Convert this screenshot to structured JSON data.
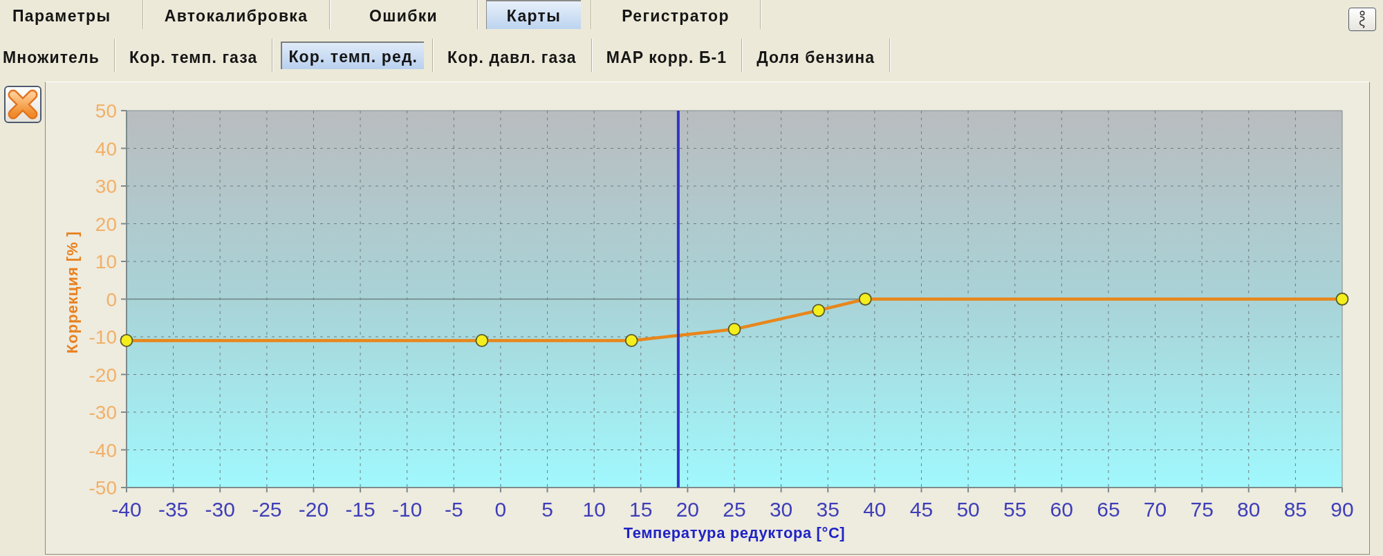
{
  "tabs": [
    {
      "label": "Параметры",
      "selected": false
    },
    {
      "label": "Автокалибровка",
      "selected": false
    },
    {
      "label": "Ошибки",
      "selected": false
    },
    {
      "label": "Карты",
      "selected": true
    },
    {
      "label": "Регистратор",
      "selected": false
    }
  ],
  "subtabs": [
    {
      "label": "Множитель",
      "selected": false
    },
    {
      "label": "Кор. темп. газа",
      "selected": false
    },
    {
      "label": "Кор. темп. ред.",
      "selected": true
    },
    {
      "label": "Кор. давл. газа",
      "selected": false
    },
    {
      "label": "MAP корр. Б-1",
      "selected": false
    },
    {
      "label": "Доля бензина",
      "selected": false
    }
  ],
  "chart": {
    "chart_data": {
      "type": "line",
      "xlabel": "Температура редуктора [°C]",
      "ylabel": "Коррекция [% ]",
      "x": [
        -40,
        -2,
        14,
        25,
        34,
        39,
        90
      ],
      "series": [
        {
          "color": "#e8861a",
          "marker": "circle",
          "values": [
            -11,
            -11,
            -11,
            -8,
            -3,
            0,
            0
          ]
        }
      ],
      "xlim": [
        -40,
        90
      ],
      "ylim": [
        -50,
        50
      ],
      "xticks": [
        -40,
        -35,
        -30,
        -25,
        -20,
        -15,
        -10,
        -5,
        0,
        5,
        10,
        15,
        20,
        25,
        30,
        35,
        40,
        45,
        50,
        55,
        60,
        65,
        70,
        75,
        80,
        85,
        90
      ],
      "yticks": [
        -50,
        -40,
        -30,
        -20,
        -10,
        0,
        10,
        20,
        30,
        40,
        50
      ],
      "grid": true,
      "ref_lines": [
        {
          "axis": "x",
          "value": 19
        }
      ]
    }
  }
}
